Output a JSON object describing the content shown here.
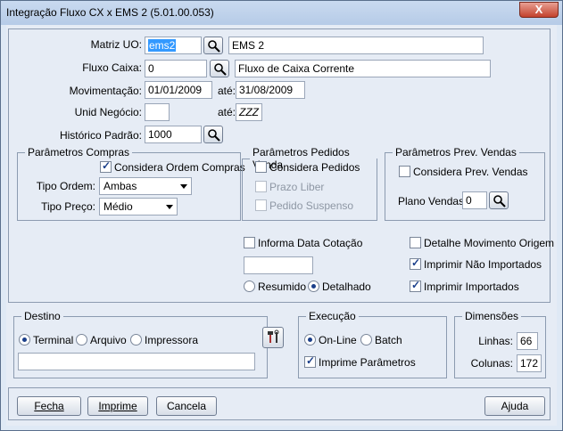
{
  "window": {
    "title": "Integração Fluxo CX x EMS 2 (5.01.00.053)",
    "close_label": "X"
  },
  "fields": {
    "matriz_uo": {
      "label": "Matriz UO:",
      "value": "ems2",
      "desc": "EMS 2"
    },
    "fluxo_caixa": {
      "label": "Fluxo Caixa:",
      "value": "0",
      "desc": "Fluxo de Caixa Corrente"
    },
    "movimentacao": {
      "label": "Movimentação:",
      "from": "01/01/2009",
      "ate_label": "até:",
      "to": "31/08/2009"
    },
    "unid_negocio": {
      "label": "Unid Negócio:",
      "from": "",
      "ate_label": "até:",
      "to": "ZZZ"
    },
    "historico": {
      "label": "Histórico Padrão:",
      "value": "1000"
    }
  },
  "compras": {
    "legend": "Parâmetros Compras",
    "considera_ordem": "Considera Ordem Compras",
    "tipo_ordem_label": "Tipo Ordem:",
    "tipo_ordem_value": "Ambas",
    "tipo_preco_label": "Tipo Preço:",
    "tipo_preco_value": "Médio"
  },
  "pedidos": {
    "legend": "Parâmetros Pedidos Venda",
    "considera": "Considera Pedidos",
    "prazo": "Prazo Liber",
    "suspenso": "Pedido Suspenso"
  },
  "prev": {
    "legend": "Parâmetros Prev. Vendas",
    "considera": "Considera Prev. Vendas",
    "plano_label": "Plano Vendas:",
    "plano_value": "0"
  },
  "options": {
    "informa_data": "Informa Data Cotação",
    "data_value": "",
    "resumido": "Resumido",
    "detalhado": "Detalhado",
    "detalhe_mov": "Detalhe Movimento Origem",
    "imprimir_nao": "Imprimir Não Importados",
    "imprimir_imp": "Imprimir Importados"
  },
  "destino": {
    "legend": "Destino",
    "terminal": "Terminal",
    "arquivo": "Arquivo",
    "impressora": "Impressora",
    "path": ""
  },
  "execucao": {
    "legend": "Execução",
    "online": "On-Line",
    "batch": "Batch",
    "imprime_param": "Imprime Parâmetros"
  },
  "dimensoes": {
    "legend": "Dimensões",
    "linhas_label": "Linhas:",
    "linhas_value": "66",
    "colunas_label": "Colunas:",
    "colunas_value": "172"
  },
  "buttons": {
    "fecha": "Fecha",
    "imprime": "Imprime",
    "cancela": "Cancela",
    "ajuda": "Ajuda"
  }
}
